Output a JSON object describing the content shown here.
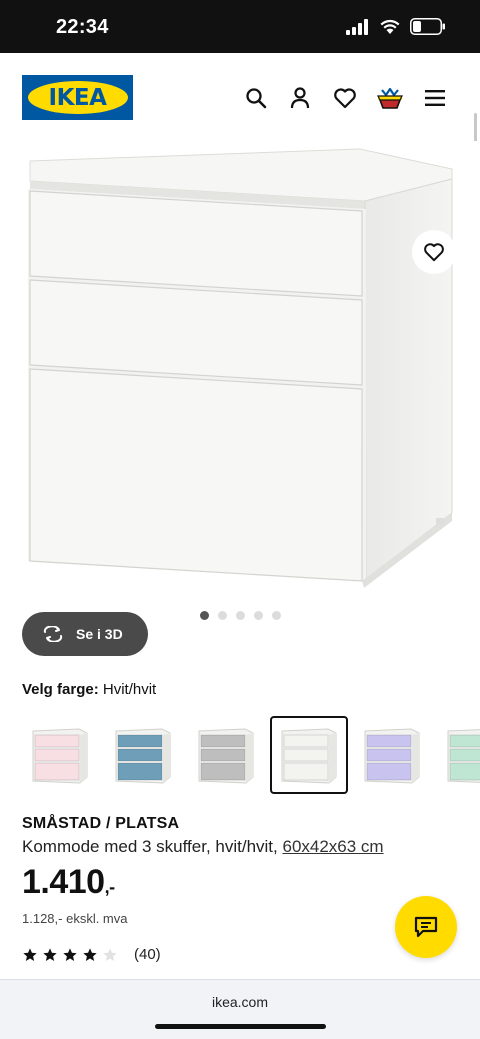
{
  "status_bar": {
    "time": "22:34"
  },
  "header": {
    "logo_text": "IKEA",
    "icons": [
      "search-icon",
      "account-icon",
      "heart-icon",
      "basket-icon",
      "menu-icon"
    ]
  },
  "hero": {
    "view_3d_label": "Se i 3D",
    "carousel": {
      "total": 5,
      "active_index": 0
    }
  },
  "color_picker": {
    "label": "Velg farge:",
    "selected_value": "Hvit/hvit",
    "swatches": [
      {
        "color": "#f7dfe4",
        "selected": false
      },
      {
        "color": "#6f9fb8",
        "selected": false
      },
      {
        "color": "#bebebe",
        "selected": false
      },
      {
        "color": "#f3f3f0",
        "selected": true
      },
      {
        "color": "#c9c3ef",
        "selected": false
      },
      {
        "color": "#bfe5d3",
        "selected": false
      }
    ]
  },
  "product": {
    "name": "SMÅSTAD / PLATSA",
    "description": "Kommode med 3 skuffer, hvit/hvit,",
    "size": "60x42x63 cm",
    "price": "1.410",
    "price_suffix": ",-",
    "price_ex_vat": "1.128,- ekskl. mva",
    "rating": {
      "stars": 4,
      "max": 5,
      "count": "(40)"
    }
  },
  "browser": {
    "url": "ikea.com"
  },
  "colors": {
    "brand_blue": "#0058a3",
    "brand_yellow": "#ffdb00"
  }
}
